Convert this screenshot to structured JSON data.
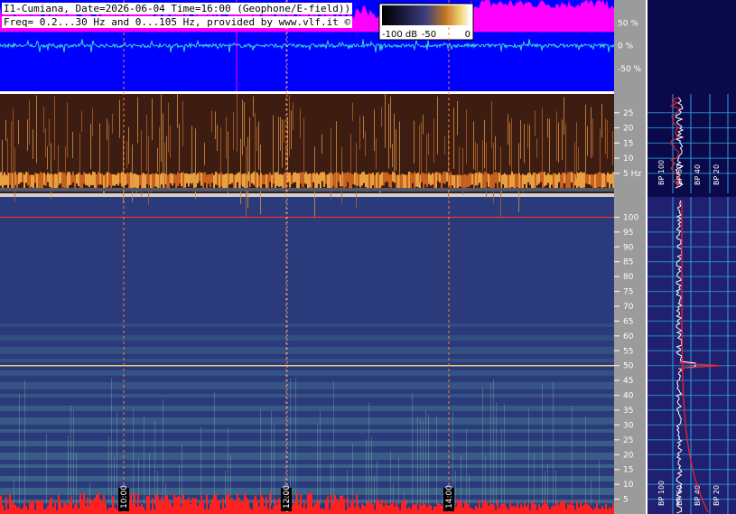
{
  "header": {
    "line1": "I1-Cumiana, Date=2026-06-04 Time=16:00 (Geophone/E-field))",
    "line2": "Freq= 0.2...30 Hz and 0...105 Hz, provided by www.vlf.it ©"
  },
  "colorbar": {
    "labels": [
      "-100 dB",
      "-50",
      "0"
    ]
  },
  "colors": {
    "spec_bg": "#2a3a7a",
    "low_bg": "#3d1d12",
    "amp_bg": "#0000ff",
    "amp_trace": "#ff00ff",
    "cursor": "#ff8040",
    "side_bg": "#0a0a4a",
    "side_grid": "#2aa0e0",
    "side_bottom_bg": "#202070",
    "bp_trace": "#ffffff",
    "bp_ref": "#ff2020"
  },
  "chart_data": [
    {
      "type": "line",
      "title": "",
      "ylabel": "",
      "y_ticks": [
        "50 %",
        "0 %",
        "-50 %"
      ],
      "ylim": [
        -100,
        100
      ]
    },
    {
      "type": "heatmap",
      "title": "",
      "ylabel": "",
      "y_ticks": [
        {
          "v": 25,
          "label": "25"
        },
        {
          "v": 20,
          "label": "20"
        },
        {
          "v": 15,
          "label": "15"
        },
        {
          "v": 10,
          "label": "10"
        },
        {
          "v": 5,
          "label": "5 Hz"
        }
      ],
      "ylim": [
        0.2,
        30
      ],
      "side_x_labels": [
        "BP 100",
        "BP 60",
        "BP 40",
        "BP 20"
      ]
    },
    {
      "type": "heatmap",
      "title": "",
      "ylabel": "",
      "y_ticks": [
        100,
        95,
        90,
        85,
        80,
        75,
        70,
        65,
        60,
        55,
        50,
        45,
        40,
        35,
        30,
        25,
        20,
        15,
        10,
        5
      ],
      "ylim": [
        0,
        105
      ],
      "side_x_labels": [
        "BP 100",
        "BP 60",
        "BP 40",
        "BP 20"
      ],
      "time_markers": [
        {
          "label": "10:00",
          "offset_h": 1.0
        },
        {
          "label": "12:00",
          "offset_h": 2.0
        },
        {
          "label": "14:00",
          "offset_h": 3.0
        }
      ]
    }
  ]
}
